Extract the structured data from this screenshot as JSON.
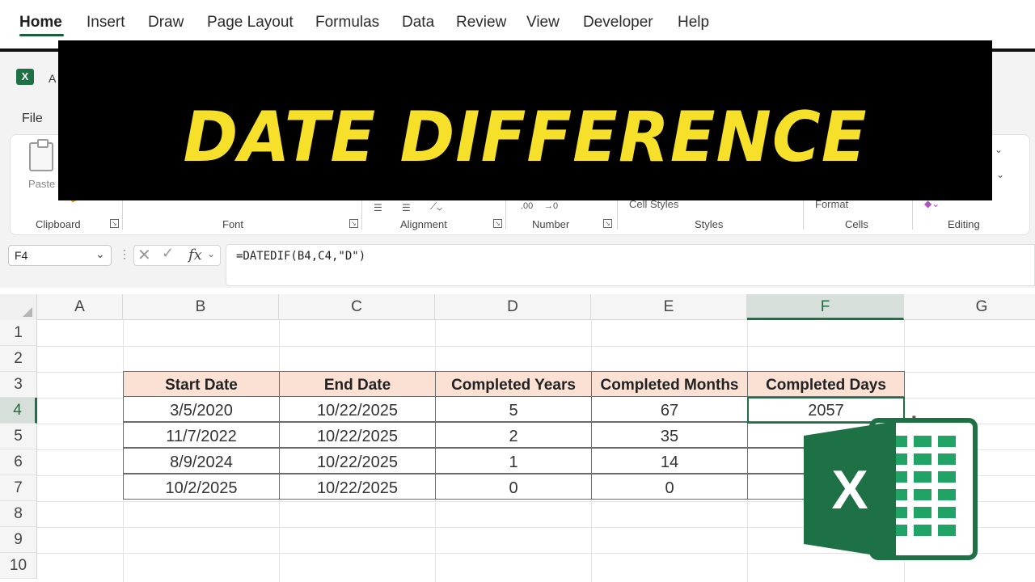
{
  "menu": {
    "items": [
      "Home",
      "Insert",
      "Draw",
      "Page Layout",
      "Formulas",
      "Data",
      "Review",
      "View",
      "Developer",
      "Help"
    ]
  },
  "app": {
    "title_fragment": "A",
    "file_tab": "File",
    "logo_letter": "X"
  },
  "ribbon": {
    "paste_label": "Paste",
    "groups": [
      "Clipboard",
      "Font",
      "Alignment",
      "Number",
      "Styles",
      "Cells",
      "Editing"
    ],
    "number_decimals": ".00",
    "number_arrow": "→0",
    "cell_styles": "Cell Styles",
    "format_label": "Format"
  },
  "banner": {
    "title": "DATE DIFFERENCE"
  },
  "formula_bar": {
    "name_box": "F4",
    "fx": "fx",
    "formula": "=DATEDIF(B4,C4,\"D\")"
  },
  "sheet": {
    "columns": [
      "A",
      "B",
      "C",
      "D",
      "E",
      "F",
      "G"
    ],
    "rows": [
      "1",
      "2",
      "3",
      "4",
      "5",
      "6",
      "7",
      "8",
      "9",
      "10"
    ],
    "selected_column": "F",
    "selected_row": "4",
    "table": {
      "headers": [
        "Start Date",
        "End Date",
        "Completed Years",
        "Completed Months",
        "Completed Days"
      ],
      "rows": [
        [
          "3/5/2020",
          "10/22/2025",
          "5",
          "67",
          "2057"
        ],
        [
          "11/7/2022",
          "10/22/2025",
          "2",
          "35",
          ""
        ],
        [
          "8/9/2024",
          "10/22/2025",
          "1",
          "14",
          ""
        ],
        [
          "10/2/2025",
          "10/22/2025",
          "0",
          "0",
          ""
        ]
      ]
    }
  },
  "colors": {
    "excel_green": "#1e7145",
    "banner_yellow": "#f6e02a",
    "header_fill": "#fbe0d4"
  }
}
